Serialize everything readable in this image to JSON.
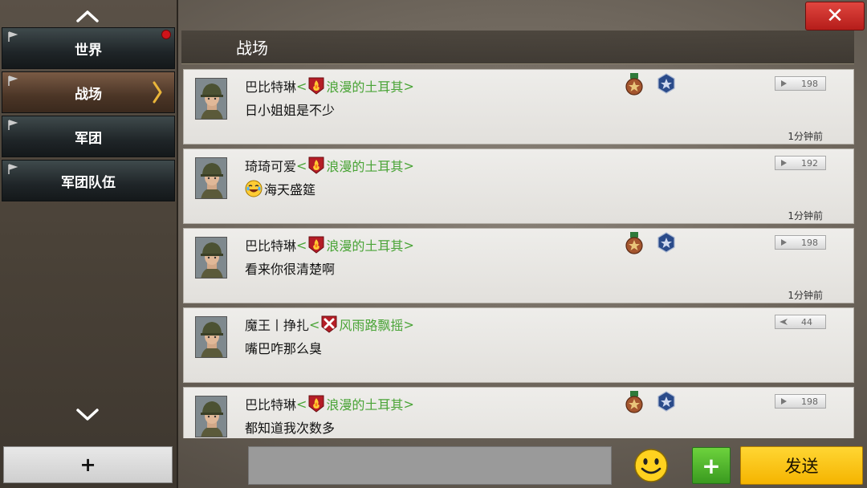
{
  "sidebar": {
    "tabs": [
      {
        "label": "世界",
        "unread": true,
        "active": false
      },
      {
        "label": "战场",
        "unread": false,
        "active": true
      },
      {
        "label": "军团",
        "unread": false,
        "active": false
      },
      {
        "label": "军团队伍",
        "unread": false,
        "active": false
      }
    ],
    "add_label": "+"
  },
  "header": {
    "title": "战场",
    "close_label": "✕"
  },
  "messages": [
    {
      "sender": "巴比特琳",
      "bracket_open": "<",
      "legion": "浪漫的土耳其",
      "bracket_close": ">",
      "text": "日小姐姐是不少",
      "level": "198",
      "time": "1分钟前",
      "has_medals": true,
      "badge": "fire",
      "emoji": false
    },
    {
      "sender": "琦琦可爱",
      "bracket_open": "<",
      "legion": "浪漫的土耳其",
      "bracket_close": ">",
      "text": "海天盛筵",
      "level": "192",
      "time": "1分钟前",
      "has_medals": false,
      "badge": "fire",
      "emoji": true
    },
    {
      "sender": "巴比特琳",
      "bracket_open": "<",
      "legion": "浪漫的土耳其",
      "bracket_close": ">",
      "text": "看来你很清楚啊",
      "level": "198",
      "time": "1分钟前",
      "has_medals": true,
      "badge": "fire",
      "emoji": false
    },
    {
      "sender": "魔王丨挣扎",
      "bracket_open": "<",
      "legion": "风雨路飘摇",
      "bracket_close": ">",
      "text": "嘴巴咋那么臭",
      "level": "44",
      "time": "",
      "has_medals": false,
      "badge": "cross",
      "emoji": false
    },
    {
      "sender": "巴比特琳",
      "bracket_open": "<",
      "legion": "浪漫的土耳其",
      "bracket_close": ">",
      "text": "都知道我次数多",
      "level": "198",
      "time": "",
      "has_medals": true,
      "badge": "fire",
      "emoji": false
    }
  ],
  "composer": {
    "input_value": "",
    "attach_label": "+",
    "send_label": "发送"
  },
  "colors": {
    "legion_green": "#4aa437",
    "send_yellow": "#f5b400",
    "close_red": "#c0231f",
    "attach_green": "#4caf28"
  }
}
